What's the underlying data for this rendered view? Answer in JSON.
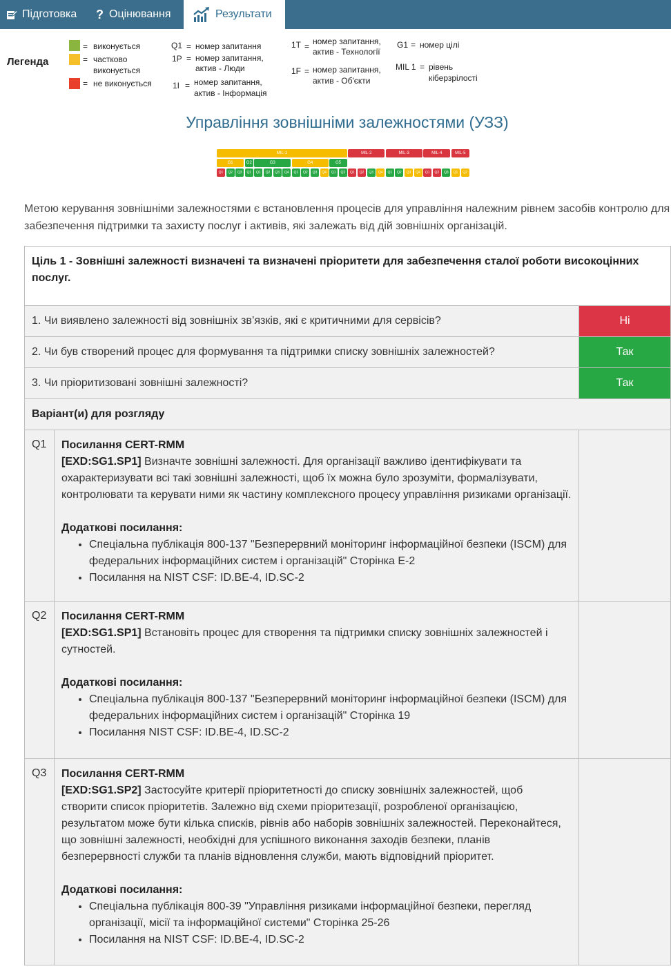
{
  "nav": {
    "tabs": [
      {
        "label": "Підготовка",
        "icon": "edit-icon"
      },
      {
        "label": "Оцінювання",
        "icon": "question-icon"
      },
      {
        "label": "Результати",
        "icon": "chart-icon",
        "active": true
      }
    ]
  },
  "legend": {
    "title": "Легенда",
    "colors": {
      "implemented": "#8ab53f",
      "partial": "#f5c02a",
      "not_implemented": "#e8402a"
    },
    "implemented": "виконується",
    "partial_1": "частково",
    "partial_2": "виконується",
    "not_implemented": "не виконується",
    "eq": "=",
    "q1_key": "Q1",
    "q1_val": "номер запитання",
    "p1_key": "1P",
    "p1_val_1": "номер запитання,",
    "p1_val_2": "актив - Люди",
    "i1_key": "1I",
    "i1_val_1": "номер запитання,",
    "i1_val_2": "актив - Інформація",
    "t1_key": "1T",
    "t1_val_1": "номер запитання,",
    "t1_val_2": "актив - Технології",
    "f1_key": "1F",
    "f1_val_1": "номер запитання,",
    "f1_val_2": "актив - Об'єкти",
    "g1_key": "G1",
    "g1_val": "номер цілі",
    "mil_key": "MIL 1",
    "mil_val_1": "рівень",
    "mil_val_2": "кіберзрілості"
  },
  "page_title": "Управління зовнішніми залежностями (УЗЗ)",
  "mil_chart": {
    "colors": {
      "yellow": "#f5bc00",
      "red": "#d8353f",
      "green": "#28a745"
    },
    "levels": [
      {
        "label": "MIL-1",
        "color": "yellow"
      },
      {
        "label": "MIL-2",
        "color": "red"
      },
      {
        "label": "MIL-3",
        "color": "red"
      },
      {
        "label": "MIL-4",
        "color": "red"
      },
      {
        "label": "MIL-5",
        "color": "red"
      }
    ],
    "goals": [
      {
        "label": "G1",
        "color": "yellow"
      },
      {
        "label": "G2",
        "color": "green"
      },
      {
        "label": "G3",
        "color": "green"
      },
      {
        "label": "G4",
        "color": "yellow"
      },
      {
        "label": "G5",
        "color": "green"
      }
    ],
    "questions": [
      {
        "label": "Q1",
        "color": "red"
      },
      {
        "label": "Q2",
        "color": "green"
      },
      {
        "label": "Q3",
        "color": "green"
      },
      {
        "label": "Q1",
        "color": "green"
      },
      {
        "label": "Q1",
        "color": "green"
      },
      {
        "label": "Q2",
        "color": "green"
      },
      {
        "label": "Q3",
        "color": "green"
      },
      {
        "label": "Q4",
        "color": "green"
      },
      {
        "label": "Q1",
        "color": "green"
      },
      {
        "label": "Q2",
        "color": "green"
      },
      {
        "label": "Q3",
        "color": "green"
      },
      {
        "label": "Q4",
        "color": "yellow"
      },
      {
        "label": "Q1",
        "color": "green"
      },
      {
        "label": "Q2",
        "color": "green"
      },
      {
        "label": "Q1",
        "color": "red"
      },
      {
        "label": "Q2",
        "color": "red"
      },
      {
        "label": "Q3",
        "color": "green"
      },
      {
        "label": "Q4",
        "color": "yellow"
      },
      {
        "label": "Q1",
        "color": "green"
      },
      {
        "label": "Q2",
        "color": "green"
      },
      {
        "label": "Q3",
        "color": "yellow"
      },
      {
        "label": "Q4",
        "color": "yellow"
      },
      {
        "label": "Q1",
        "color": "red"
      },
      {
        "label": "Q2",
        "color": "red"
      },
      {
        "label": "Q3",
        "color": "green"
      },
      {
        "label": "Q1",
        "color": "yellow"
      },
      {
        "label": "Q2",
        "color": "yellow"
      }
    ]
  },
  "intro": "Метою керування зовнішніми залежностями є встановлення процесів для управління належним рівнем засобів контролю для забезпечення підтримки та захисту послуг і активів, які залежать від дій зовнішніх організацій.",
  "goal": {
    "title": "Ціль 1 - Зовнішні залежності визначені та визначені пріоритети для забезпечення сталої роботи високоцінних послуг.",
    "questions": [
      {
        "text": "1. Чи виявлено залежності від зовнішніх зв’язків, які є критичними для сервісів?",
        "answer": "Ні",
        "answer_color": "#dc3545"
      },
      {
        "text": "2. Чи був створений процес для формування та підтримки списку зовнішніх залежностей?",
        "answer": "Так",
        "answer_color": "#28a745"
      },
      {
        "text": "3. Чи пріоритизовані зовнішні залежності?",
        "answer": "Так",
        "answer_color": "#28a745"
      }
    ],
    "options_heading": "Варіант(и) для розгляду",
    "options": [
      {
        "id": "Q1",
        "ref_title": "Посилання CERT-RMM",
        "ref_code": "[EXD:SG1.SP1]",
        "ref_text": " Визначте зовнішні залежності. Для організації важливо ідентифікувати та охарактеризувати всі такі зовнішні залежності, щоб їх можна було зрозуміти, формалізувати, контролювати та керувати ними як частину комплексного процесу управління ризиками організації.",
        "extra_title": "Додаткові посилання:",
        "extra": [
          "Спеціальна публікація 800-137 \"Безперервний моніторинг інформаційної безпеки (ISCM) для федеральних інформаційних систем і організацій\" Сторінка E-2",
          "Посилання на NIST CSF: ID.BE-4, ID.SC-2"
        ]
      },
      {
        "id": "Q2",
        "ref_title": "Посилання CERT-RMM",
        "ref_code": "[EXD:SG1.SP1]",
        "ref_text": " Встановіть процес для створення та підтримки списку зовнішніх залежностей і сутностей.",
        "extra_title": "Додаткові посилання:",
        "extra": [
          "Спеціальна публікація 800-137 \"Безперервний моніторинг інформаційної безпеки (ISCM) для федеральних інформаційних систем і організацій\" Сторінка 19",
          "Посилання NIST CSF: ID.BE-4, ID.SC-2"
        ]
      },
      {
        "id": "Q3",
        "ref_title": "Посилання CERT-RMM",
        "ref_code": "[EXD:SG1.SP2]",
        "ref_text": " Застосуйте критерії пріоритетності до списку зовнішніх залежностей, щоб створити список пріоритетів. Залежно від схеми пріоритезації, розробленої організацією, результатом може бути кілька списків, рівнів або наборів зовнішніх залежностей. Переконайтеся, що зовнішні залежності, необхідні для успішного виконання заходів безпеки, планів безперервності служби та планів відновлення служби, мають відповідний пріоритет.",
        "extra_title": "Додаткові посилання:",
        "extra": [
          "Спеціальна публікація 800-39 \"Управління ризиками інформаційної безпеки, перегляд організації, місії та інформаційної системи\" Сторінка 25-26",
          "Посилання на NIST CSF: ID.BE-4, ID.SC-2"
        ]
      }
    ]
  }
}
